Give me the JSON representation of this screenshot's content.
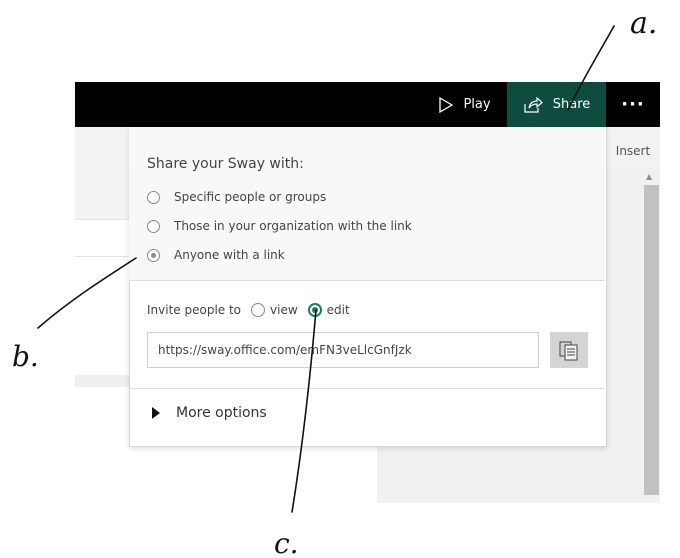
{
  "topbar": {
    "play_label": "Play",
    "share_label": "Share",
    "more_label": "···"
  },
  "editor": {
    "insert_tab": "Insert"
  },
  "share_dialog": {
    "title": "Share your Sway with:",
    "options": [
      {
        "label": "Specific people or groups",
        "selected": false
      },
      {
        "label": "Those in your organization with the link",
        "selected": false
      },
      {
        "label": "Anyone with a link",
        "selected": true
      }
    ],
    "invite_prefix": "Invite people to",
    "permission_options": [
      {
        "label": "view",
        "selected": false
      },
      {
        "label": "edit",
        "selected": true
      }
    ],
    "link_url": "https://sway.office.com/emFN3veLlcGnfJzk",
    "more_options_label": "More options"
  },
  "annotations": {
    "a": "a.",
    "b": "b.",
    "c": "c."
  },
  "colors": {
    "topbar_bg": "#000000",
    "share_active_bg": "#0d4c3f",
    "radio_accent": "#1f7a6a"
  }
}
